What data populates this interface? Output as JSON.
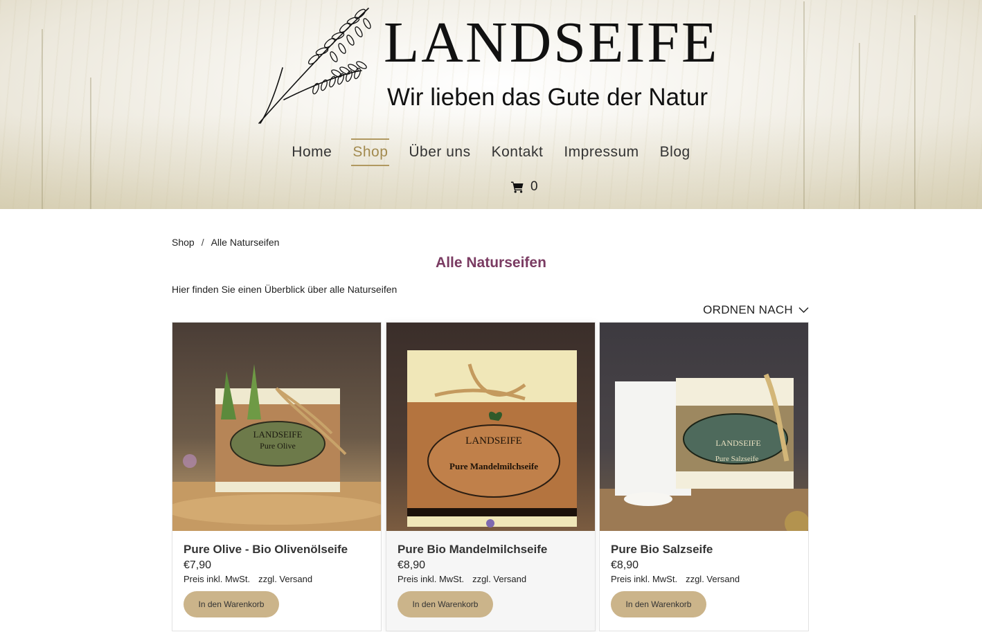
{
  "header": {
    "logo": {
      "title": "LANDSEIFE",
      "subtitle": "Wir lieben das Gute der Natur"
    },
    "nav": [
      {
        "label": "Home",
        "active": false
      },
      {
        "label": "Shop",
        "active": true
      },
      {
        "label": "Über uns",
        "active": false
      },
      {
        "label": "Kontakt",
        "active": false
      },
      {
        "label": "Impressum",
        "active": false
      },
      {
        "label": "Blog",
        "active": false
      }
    ],
    "cart": {
      "icon": "shopping-cart-icon",
      "count": "0"
    }
  },
  "breadcrumb": {
    "items": [
      "Shop",
      "Alle Naturseifen"
    ],
    "separator": "/"
  },
  "page": {
    "title": "Alle Naturseifen",
    "intro": "Hier finden Sie einen Überblick über alle Naturseifen",
    "sort_label": "ORDNEN NACH"
  },
  "products": [
    {
      "name": "Pure Olive - Bio Olivenölseife",
      "price": "€7,90",
      "tax": "Preis inkl. MwSt.",
      "shipping": "zzgl. Versand",
      "button": "In den Warenkorb",
      "label_text": "Pure Olive",
      "label_brand": "LANDSEIFE"
    },
    {
      "name": "Pure Bio Mandelmilchseife",
      "price": "€8,90",
      "tax": "Preis inkl. MwSt.",
      "shipping": "zzgl. Versand",
      "button": "In den Warenkorb",
      "label_text": "Pure Mandelmilchseife",
      "label_brand": "LANDSEIFE"
    },
    {
      "name": "Pure Bio Salzseife",
      "price": "€8,90",
      "tax": "Preis inkl. MwSt.",
      "shipping": "zzgl. Versand",
      "button": "In den Warenkorb",
      "label_text": "Pure Salzseife",
      "label_brand": "LANDSEIFE"
    }
  ],
  "colors": {
    "accent": "#b09860",
    "title": "#7a3b62",
    "button": "#cbb48a"
  }
}
